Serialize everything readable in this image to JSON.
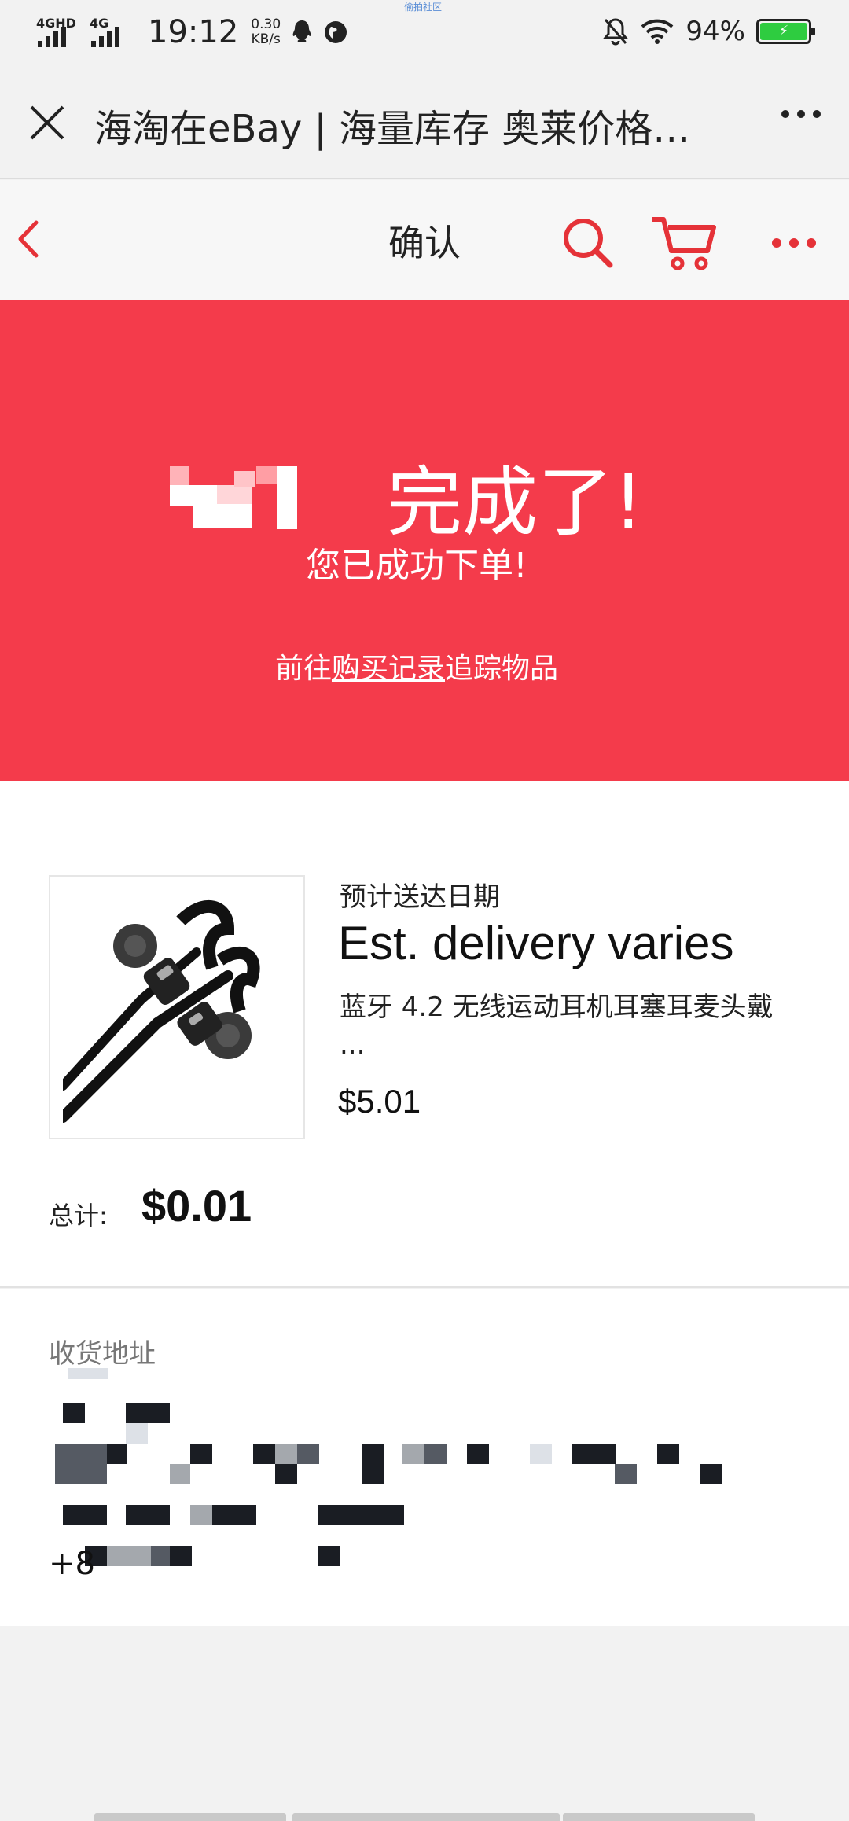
{
  "status_bar": {
    "network_1": "4GHD",
    "network_2": "4G",
    "time": "19:12",
    "speed_value": "0.30",
    "speed_unit": "KB/s",
    "watermark": "偷拍社区",
    "battery": "94%"
  },
  "browser": {
    "title": "海淘在eBay | 海量库存 奥莱价格…"
  },
  "ebay_header": {
    "title": "确认"
  },
  "banner": {
    "title": "完成了!",
    "subtitle": "您已成功下单!",
    "link_prefix": "前往",
    "link_text": "购买记录",
    "link_suffix": "追踪物品",
    "color": "#f43b4b"
  },
  "order": {
    "est_label": "预计送达日期",
    "est_value": "Est. delivery varies",
    "product_title": "蓝牙 4.2 无线运动耳机耳塞耳麦头戴",
    "product_title_ellipsis": "...",
    "price": "$5.01",
    "total_label": "总计:",
    "total_value": "$0.01"
  },
  "shipping": {
    "label": "收货地址",
    "phone_prefix": "+8"
  },
  "accent_color": "#e53238"
}
